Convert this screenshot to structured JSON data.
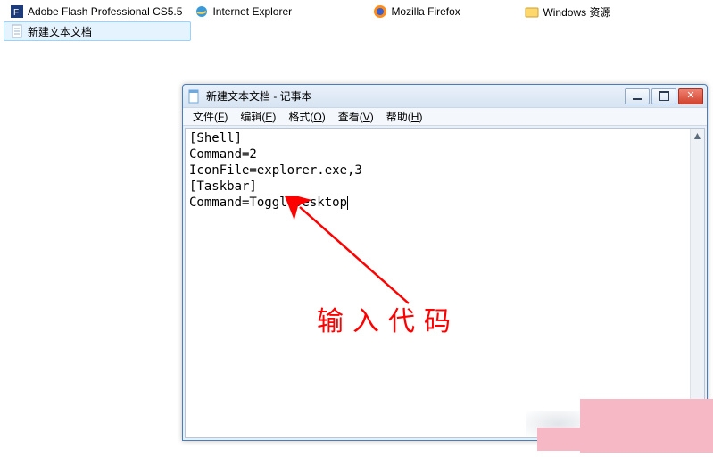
{
  "taskbar": {
    "items": [
      {
        "label": "Adobe Flash Professional CS5.5"
      },
      {
        "label": "Internet Explorer"
      },
      {
        "label": "Mozilla Firefox"
      },
      {
        "label": "Windows 资源"
      },
      {
        "label": "新建文本文档"
      }
    ]
  },
  "notepad": {
    "title": "新建文本文档 - 记事本",
    "menus": {
      "file": {
        "label": "文件",
        "accel": "F"
      },
      "edit": {
        "label": "编辑",
        "accel": "E"
      },
      "format": {
        "label": "格式",
        "accel": "O"
      },
      "view": {
        "label": "查看",
        "accel": "V"
      },
      "help": {
        "label": "帮助",
        "accel": "H"
      }
    },
    "content": "[Shell]\nCommand=2\nIconFile=explorer.exe,3\n[Taskbar]\nCommand=ToggleDesktop"
  },
  "annotation": {
    "label": "输入代码"
  }
}
